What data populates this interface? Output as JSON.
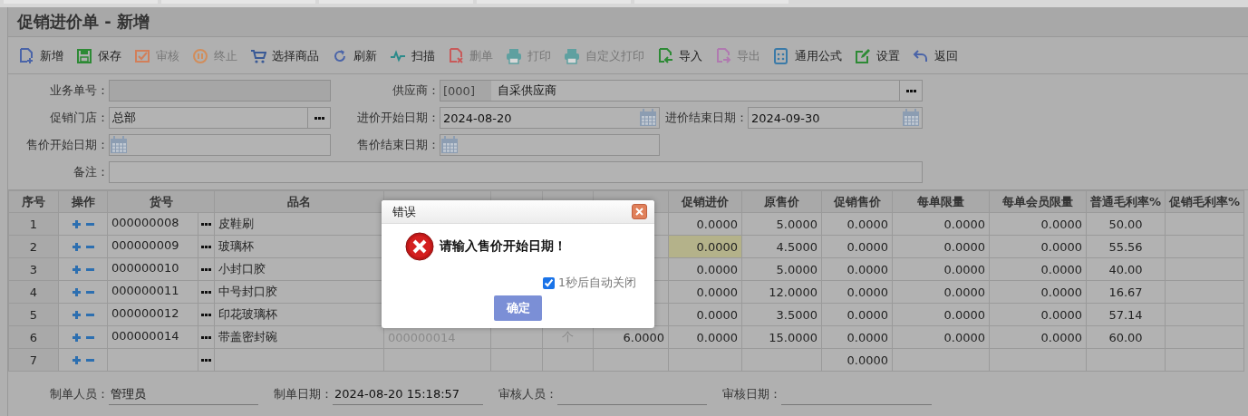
{
  "window": {
    "title": "促销进价单 - 新增"
  },
  "toolbar": [
    {
      "label": "新增",
      "kind": "new",
      "disabled": false
    },
    {
      "label": "保存",
      "kind": "save",
      "disabled": false
    },
    {
      "label": "审核",
      "kind": "approve",
      "disabled": true
    },
    {
      "label": "终止",
      "kind": "stop",
      "disabled": true
    },
    {
      "label": "选择商品",
      "kind": "pick",
      "disabled": false
    },
    {
      "label": "刷新",
      "kind": "refresh",
      "disabled": false
    },
    {
      "label": "扫描",
      "kind": "scan",
      "disabled": false
    },
    {
      "label": "删单",
      "kind": "delete",
      "disabled": true
    },
    {
      "label": "打印",
      "kind": "print",
      "disabled": true
    },
    {
      "label": "自定义打印",
      "kind": "print",
      "disabled": true
    },
    {
      "label": "导入",
      "kind": "import",
      "disabled": false
    },
    {
      "label": "导出",
      "kind": "export",
      "disabled": true
    },
    {
      "label": "通用公式",
      "kind": "formula",
      "disabled": false
    },
    {
      "label": "设置",
      "kind": "settings",
      "disabled": false
    },
    {
      "label": "返回",
      "kind": "back",
      "disabled": false
    }
  ],
  "form": {
    "rows": [
      [
        {
          "label": "业务单号：",
          "kind": "readonly"
        },
        {
          "label": "供应商：",
          "kind": "supplier",
          "code": "[000]",
          "value": "自采供应商"
        }
      ],
      [
        {
          "label": "促销门店：",
          "kind": "picker",
          "value": "总部"
        },
        {
          "label": "进价开始日期：",
          "kind": "date",
          "value": "2024-08-20"
        },
        {
          "label": "进价结束日期：",
          "kind": "date",
          "value": "2024-09-30"
        }
      ],
      [
        {
          "label": "售价开始日期：",
          "kind": "date"
        },
        {
          "label": "售价结束日期：",
          "kind": "date"
        }
      ],
      [
        {
          "label": "备注：",
          "kind": "note"
        }
      ]
    ]
  },
  "grid": {
    "columns": [
      {
        "label": "序号",
        "kind": "index"
      },
      {
        "label": "操作",
        "kind": "actions"
      },
      {
        "label": "货号",
        "kind": "code"
      },
      {
        "label": "品名",
        "kind": "text"
      },
      {
        "kind": "muted"
      },
      {
        "kind": "muted"
      },
      {
        "kind": "muted"
      },
      {
        "kind": "num"
      },
      {
        "label": "促销进价",
        "kind": "edit"
      },
      {
        "label": "原售价",
        "kind": "num"
      },
      {
        "label": "促销售价",
        "kind": "num"
      },
      {
        "label": "每单限量",
        "kind": "num"
      },
      {
        "label": "每单会员限量",
        "kind": "num"
      },
      {
        "label": "普通毛利率%",
        "kind": "center"
      },
      {
        "label": "促销毛利率%",
        "kind": "center"
      }
    ],
    "rows": [
      {
        "cells": [
          "1",
          null,
          "000000008",
          "皮鞋刷",
          null,
          null,
          null,
          null,
          "0.0000",
          "5.0000",
          "0.0000",
          "0.0000",
          "0.0000",
          "50.00",
          null
        ],
        "editing": false
      },
      {
        "cells": [
          "2",
          null,
          "000000009",
          "玻璃杯",
          null,
          null,
          null,
          null,
          "0.0000",
          "4.5000",
          "0.0000",
          "0.0000",
          "0.0000",
          "55.56",
          null
        ],
        "editing": true
      },
      {
        "cells": [
          "3",
          null,
          "000000010",
          "小封口胶",
          null,
          null,
          null,
          null,
          "0.0000",
          "5.0000",
          "0.0000",
          "0.0000",
          "0.0000",
          "40.00",
          null
        ],
        "editing": false
      },
      {
        "cells": [
          "4",
          null,
          "000000011",
          "中号封口胶",
          null,
          null,
          null,
          null,
          "0.0000",
          "12.0000",
          "0.0000",
          "0.0000",
          "0.0000",
          "16.67",
          null
        ],
        "editing": false
      },
      {
        "cells": [
          "5",
          null,
          "000000012",
          "印花玻璃杯",
          null,
          null,
          null,
          null,
          "0.0000",
          "3.5000",
          "0.0000",
          "0.0000",
          "0.0000",
          "57.14",
          null
        ],
        "editing": false
      },
      {
        "cells": [
          "6",
          null,
          "000000014",
          "带盖密封碗",
          "000000014",
          null,
          "个",
          "6.0000",
          "0.0000",
          "15.0000",
          "0.0000",
          "0.0000",
          "0.0000",
          "60.00",
          null
        ],
        "editing": false
      },
      {
        "cells": [
          "7",
          null,
          null,
          null,
          null,
          null,
          null,
          null,
          null,
          null,
          "0.0000",
          null,
          null,
          null,
          null
        ],
        "editing": false
      }
    ]
  },
  "footer": [
    {
      "label": "制单人员：",
      "value": "管理员"
    },
    {
      "label": "制单日期：",
      "value": "2024-08-20 15:18:57"
    },
    {
      "label": "审核人员："
    },
    {
      "label": "审核日期："
    }
  ],
  "dialog": {
    "title": "错误",
    "message": "请输入售价开始日期！",
    "auto_close": {
      "label": "1秒后自动关闭",
      "checked": true
    },
    "button": "确定"
  }
}
